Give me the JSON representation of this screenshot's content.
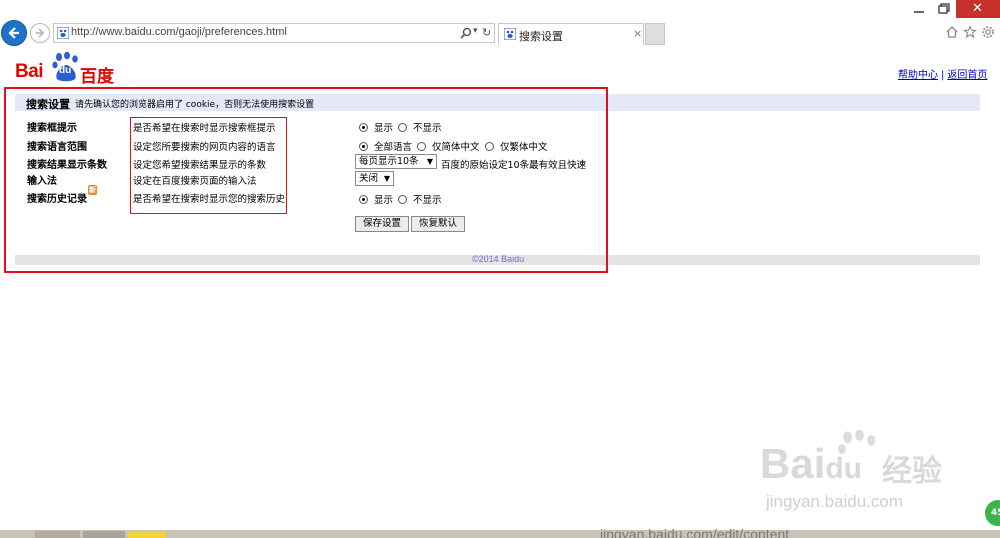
{
  "browser": {
    "url": "http://www.baidu.com/gaoji/preferences.html",
    "tab_title": "搜索设置",
    "close_glyph": "×"
  },
  "logo": {
    "bai": "Bai",
    "du": "du",
    "chinese": "百度"
  },
  "top_links": {
    "help": "帮助中心",
    "separator": "|",
    "home": "返回首页"
  },
  "settings": {
    "title": "搜索设置",
    "notice": "请先确认您的浏览器启用了 cookie，否则无法使用搜索设置",
    "rows": [
      {
        "label": "搜索框提示",
        "desc": "是否希望在搜索时显示搜索框提示",
        "options": [
          "显示",
          "不显示"
        ],
        "selected": 0
      },
      {
        "label": "搜索语言范围",
        "desc": "设定您所要搜索的网页内容的语言",
        "options": [
          "全部语言",
          "仅简体中文",
          "仅繁体中文"
        ],
        "selected": 0
      },
      {
        "label": "搜索结果显示条数",
        "desc": "设定您希望搜索结果显示的条数",
        "select_value": "每页显示10条",
        "hint": "百度的原始设定10条最有效且快速"
      },
      {
        "label": "输入法",
        "desc": "设定在百度搜索页面的输入法",
        "select_value": "关闭"
      },
      {
        "label": "搜索历史记录",
        "badge": "新",
        "desc": "是否希望在搜索时显示您的搜索历史",
        "options": [
          "显示",
          "不显示"
        ],
        "selected": 0
      }
    ],
    "buttons": {
      "save": "保存设置",
      "reset": "恢复默认"
    },
    "footer": "©2014 Baidu"
  },
  "watermark": {
    "bai": "Bai",
    "du": "du",
    "text": "经验",
    "url": "jingyan.baidu.com"
  },
  "taskbar": {
    "text": "jingyan.baidu.com/edit/content",
    "badge": "45"
  },
  "colors": {
    "accent_red": "#e1101b",
    "link_blue": "#0000cc",
    "title_bg": "#e3e9f7",
    "logo_red": "#e10601"
  }
}
